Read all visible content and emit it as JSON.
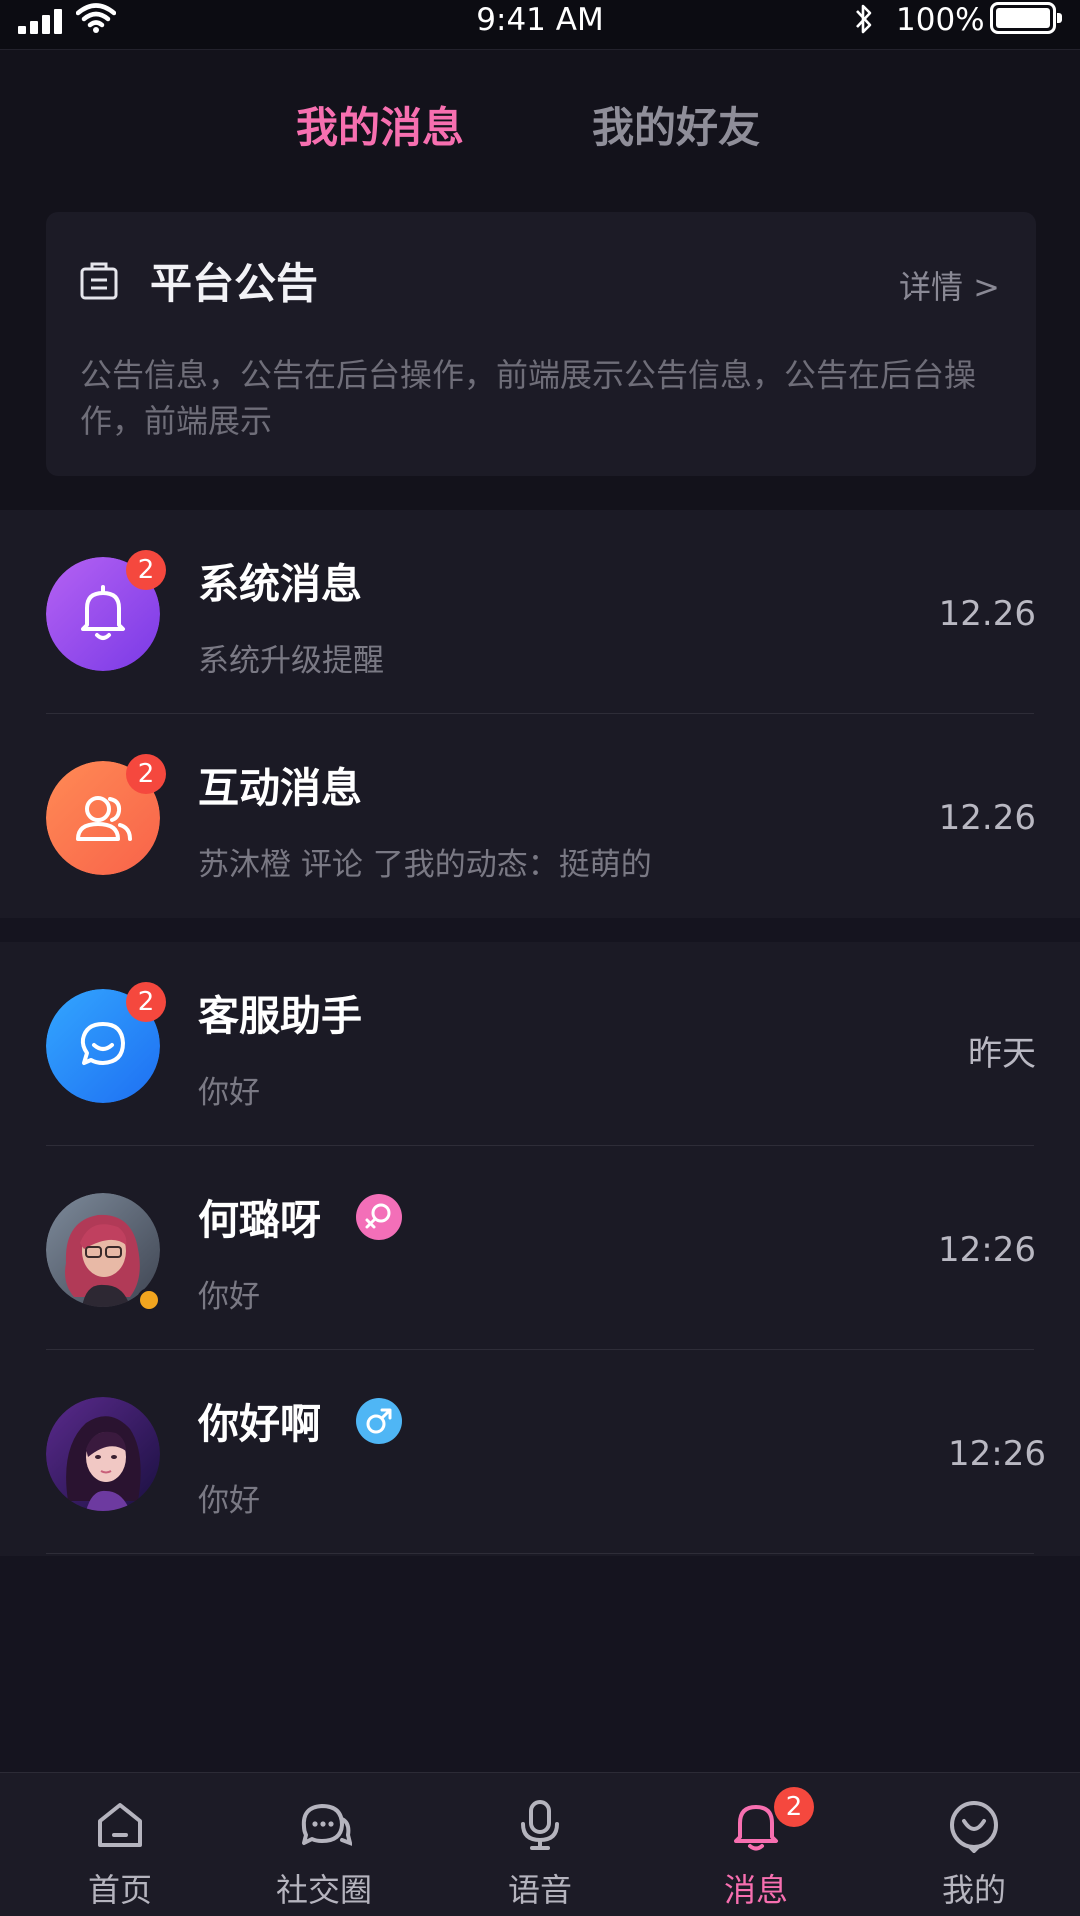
{
  "status_bar": {
    "time": "9:41 AM",
    "battery_percent": "100%",
    "battery_level": 1.0
  },
  "top_tabs": [
    {
      "label": "我的消息",
      "active": true
    },
    {
      "label": "我的好友",
      "active": false
    }
  ],
  "notice": {
    "title": "平台公告",
    "detail_link": "详情 >",
    "body": "公告信息，公告在后台操作，前端展示公告信息，公告在后台操作，前端展示"
  },
  "colors": {
    "accent": "#f76fb0",
    "badge": "#f5483e",
    "system_gradient": [
      "#b562f3",
      "#7a3ae6"
    ],
    "interaction_gradient": [
      "#ff8a55",
      "#f8634a"
    ],
    "service_gradient": [
      "#33a6ff",
      "#1e6ff2"
    ],
    "female_gender": "#f36fb8",
    "male_gender": "#4fb6f5",
    "online_dot": "#f2a51f"
  },
  "messages_group_1": [
    {
      "icon": "bell-icon",
      "badge": "2",
      "title": "系统消息",
      "subtitle": "系统升级提醒",
      "time": "12.26"
    },
    {
      "icon": "users-icon",
      "badge": "2",
      "title": "互动消息",
      "subtitle": "苏沐橙 评论 了我的动态：挺萌的",
      "time": "12.26"
    }
  ],
  "messages_group_2": [
    {
      "icon": "chat-icon",
      "badge": "2",
      "title": "客服助手",
      "subtitle": "你好",
      "time": "昨天"
    },
    {
      "icon": "avatar",
      "title": "何璐呀",
      "gender": "female",
      "online": true,
      "subtitle": "你好",
      "time": "12:26"
    },
    {
      "icon": "avatar",
      "title": "你好啊",
      "gender": "male",
      "online": false,
      "subtitle": "你好",
      "time": "12:26"
    }
  ],
  "tabbar": [
    {
      "label": "首页",
      "icon": "home-icon"
    },
    {
      "label": "社交圈",
      "icon": "social-chat-icon"
    },
    {
      "label": "语音",
      "icon": "microphone-icon"
    },
    {
      "label": "消息",
      "icon": "bell-icon",
      "active": true,
      "badge": "2"
    },
    {
      "label": "我的",
      "icon": "profile-icon"
    }
  ]
}
